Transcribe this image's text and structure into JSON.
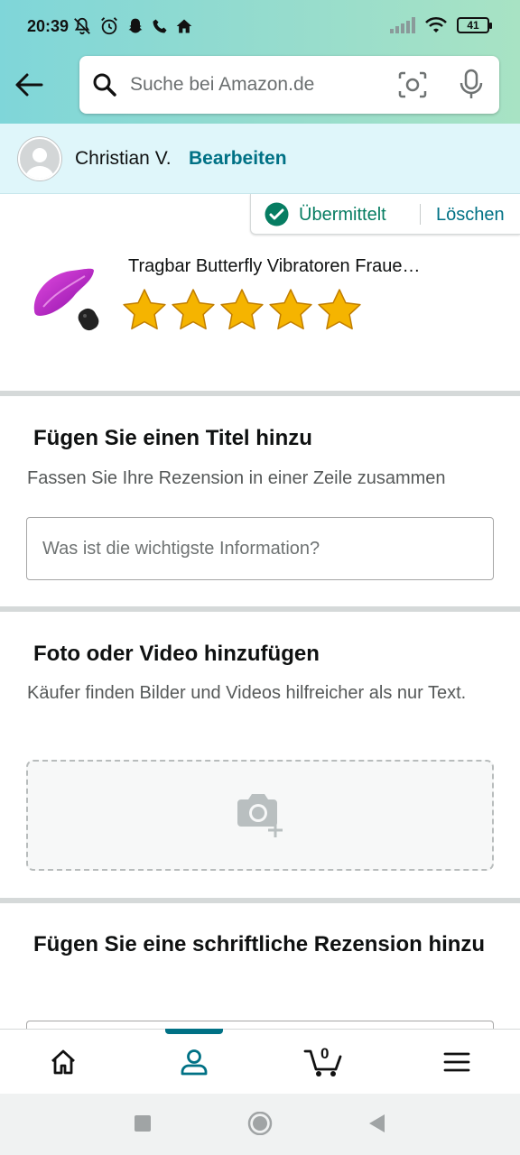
{
  "status_bar": {
    "time": "20:39",
    "battery": "41",
    "icons": [
      "mute-icon",
      "alarm-icon",
      "snapchat-icon",
      "phone-icon",
      "home-icon",
      "signal-icon",
      "wifi-icon",
      "battery-icon"
    ]
  },
  "header": {
    "search_placeholder": "Suche bei Amazon.de"
  },
  "user": {
    "name": "Christian V.",
    "edit_label": "Bearbeiten"
  },
  "review_status": {
    "submitted_label": "Übermittelt",
    "delete_label": "Löschen"
  },
  "product": {
    "title": "Tragbar Butterfly Vibratoren Fraue…",
    "rating": 5,
    "rating_max": 5
  },
  "sections": {
    "title": {
      "heading": "Fügen Sie einen Titel hinzu",
      "subtext": "Fassen Sie Ihre Rezension in einer Zeile zusammen",
      "placeholder": "Was ist die wichtigste Information?"
    },
    "media": {
      "heading": "Foto oder Video hinzufügen",
      "subtext": "Käufer finden Bilder und Videos hilfreicher als nur Text."
    },
    "written": {
      "heading": "Fügen Sie eine schriftliche Rezension hinzu"
    }
  },
  "bottom_nav": {
    "items": [
      "home-icon",
      "account-icon",
      "cart-icon",
      "menu-icon"
    ],
    "active": "account-icon",
    "cart_count": "0"
  },
  "colors": {
    "accent": "#007185",
    "success": "#067d62",
    "star": "#f5b400"
  }
}
